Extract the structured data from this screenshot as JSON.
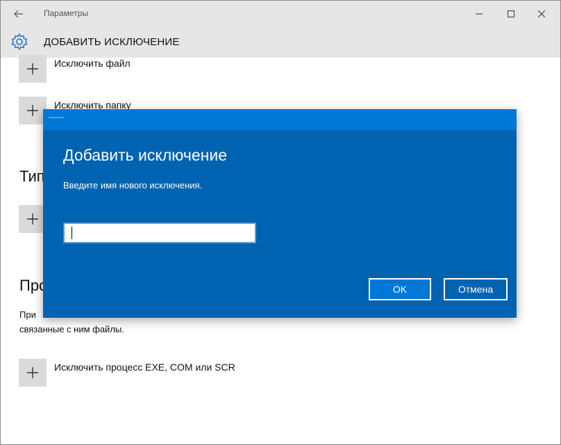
{
  "window": {
    "app_title": "Параметры",
    "page_title": "ДОБАВИТЬ ИСКЛЮЧЕНИЕ"
  },
  "content": {
    "exclude_file": "Исключить файл",
    "exclude_folder": "Исключить папку",
    "section_types_partial": "Тип",
    "section_processes_partial": "Про",
    "processes_para_line1_partial": "При",
    "processes_para_line2": "связанные с ним файлы.",
    "exclude_process": "Исключить процесс EXE, COM или SCR"
  },
  "dialog": {
    "title_glyph": "——",
    "heading": "Добавить исключение",
    "description": "Введите имя нового исключения.",
    "input_value": "",
    "ok_label": "OK",
    "cancel_label": "Отмена"
  },
  "icons": {
    "back": "back-arrow-icon",
    "minimize": "minimize-icon",
    "maximize": "maximize-icon",
    "close": "close-icon",
    "gear": "gear-icon",
    "plus": "plus-icon"
  },
  "colors": {
    "titlebar_bg": "#e6e6e6",
    "dialog_bg": "#0063b1",
    "dialog_titlebar": "#0078d7",
    "accent": "#0078d7"
  }
}
